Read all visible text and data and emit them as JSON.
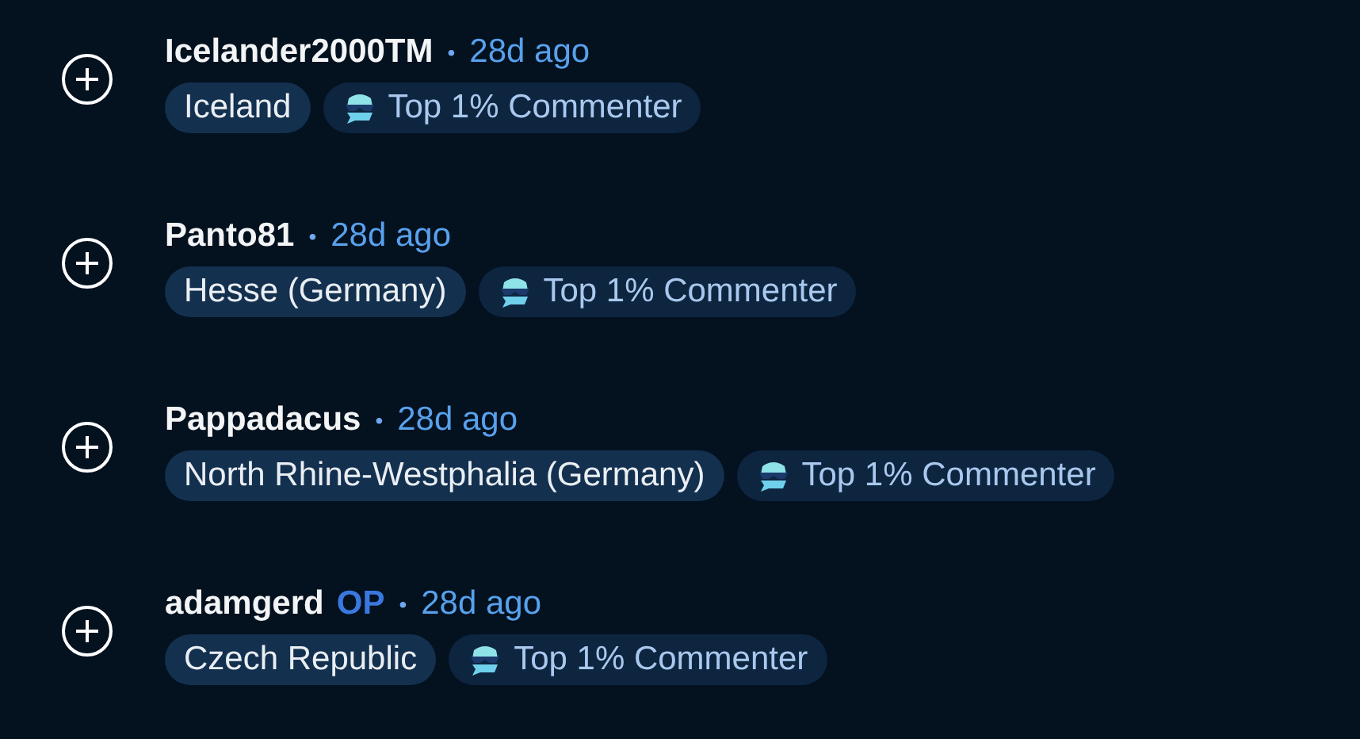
{
  "comments": [
    {
      "username": "Icelander2000TM",
      "separator": "•",
      "time": "28d ago",
      "flair": "Iceland",
      "achievement": "Top 1% Commenter"
    },
    {
      "username": "Panto81",
      "separator": "•",
      "time": "28d ago",
      "flair": "Hesse (Germany)",
      "achievement": "Top 1% Commenter"
    },
    {
      "username": "Pappadacus",
      "separator": "•",
      "time": "28d ago",
      "flair": "North Rhine-Westphalia (Germany)",
      "achievement": "Top 1% Commenter"
    },
    {
      "username": "adamgerd",
      "op_badge": "OP",
      "separator": "•",
      "time": "28d ago",
      "flair": "Czech Republic",
      "achievement": "Top 1% Commenter"
    }
  ]
}
